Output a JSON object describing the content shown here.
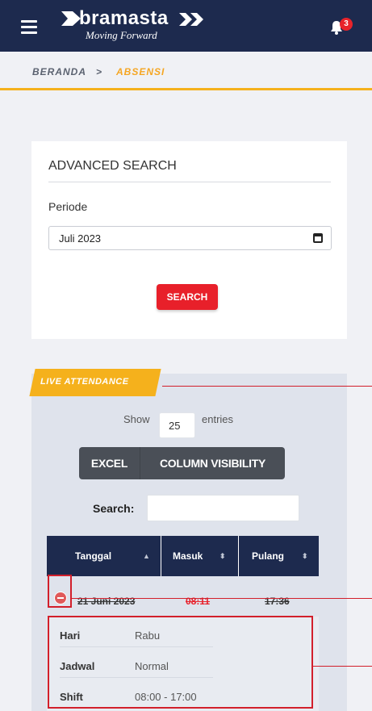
{
  "header": {
    "brand": "bramasta",
    "tagline": "Moving Forward",
    "notification_count": "3"
  },
  "breadcrumb": {
    "home": "BERANDA",
    "separator": ">",
    "current": "ABSENSI"
  },
  "advanced_search": {
    "title": "ADVANCED SEARCH",
    "periode_label": "Periode",
    "periode_value": "Juli 2023",
    "search_button": "SEARCH"
  },
  "live_attendance": {
    "tab_label": "LIVE ATTENDANCE",
    "show_label": "Show",
    "entries_value": "25",
    "entries_label": "entries",
    "buttons": {
      "excel": "EXCEL",
      "column_visibility": "COLUMN VISIBILITY"
    },
    "search_label": "Search:",
    "table": {
      "columns": [
        "Tanggal",
        "Masuk",
        "Pulang"
      ],
      "rows": [
        {
          "tanggal": "21 Juni 2023",
          "masuk": "08:11",
          "pulang": "17:36",
          "details": [
            {
              "key": "Hari",
              "value": "Rabu"
            },
            {
              "key": "Jadwal",
              "value": "Normal"
            },
            {
              "key": "Shift",
              "value": "08:00 - 17:00"
            }
          ]
        }
      ]
    }
  },
  "colors": {
    "navbar": "#1d2a4e",
    "accent": "#f5b11c",
    "danger": "#e8202a",
    "late_text": "#e8202a",
    "annotation": "#d21f2b"
  }
}
